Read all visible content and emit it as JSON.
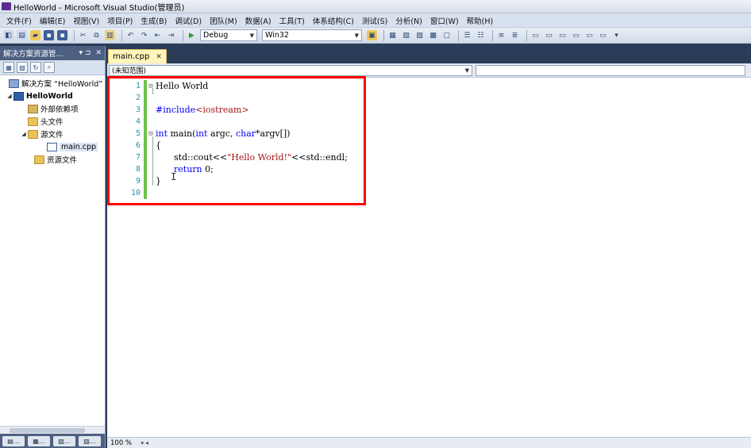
{
  "window": {
    "title": "HelloWorld - Microsoft Visual Studio(管理员)"
  },
  "menu": [
    "文件(F)",
    "编辑(E)",
    "视图(V)",
    "项目(P)",
    "生成(B)",
    "调试(D)",
    "团队(M)",
    "数据(A)",
    "工具(T)",
    "体系结构(C)",
    "测试(S)",
    "分析(N)",
    "窗口(W)",
    "帮助(H)"
  ],
  "toolbar": {
    "config": "Debug",
    "platform": "Win32"
  },
  "solution_explorer": {
    "title": "解决方案资源管...",
    "pin": "▾ ⊐",
    "close": "✕",
    "items": [
      {
        "label": "解决方案 “HelloWorld”",
        "icon": "solution-icon"
      },
      {
        "label": "HelloWorld",
        "icon": "project-icon"
      },
      {
        "label": "外部依赖项",
        "icon": "external-deps-icon"
      },
      {
        "label": "头文件",
        "icon": "folder-icon"
      },
      {
        "label": "源文件",
        "icon": "folder-icon"
      },
      {
        "label": "main.cpp",
        "icon": "cpp-file-icon"
      },
      {
        "label": "资源文件",
        "icon": "folder-icon"
      }
    ]
  },
  "editor": {
    "tab_label": "main.cpp",
    "tab_close": "✕",
    "scope_combo": "(未知范围)",
    "zoom": "100 %",
    "lines": [
      {
        "n": "1",
        "fold": "⊟",
        "html": "Hello World"
      },
      {
        "n": "2",
        "fold": "",
        "html": ""
      },
      {
        "n": "3",
        "fold": "",
        "html": "#include<iostream>"
      },
      {
        "n": "4",
        "fold": "",
        "html": ""
      },
      {
        "n": "5",
        "fold": "⊟",
        "html": "int main(int argc, char*argv[])"
      },
      {
        "n": "6",
        "fold": "",
        "html": "{"
      },
      {
        "n": "7",
        "fold": "",
        "html": "std::cout<<\"Hello World!\"<<std::endl;"
      },
      {
        "n": "8",
        "fold": "",
        "html": "return 0;"
      },
      {
        "n": "9",
        "fold": "",
        "html": "}"
      },
      {
        "n": "10",
        "fold": "",
        "html": ""
      }
    ]
  }
}
